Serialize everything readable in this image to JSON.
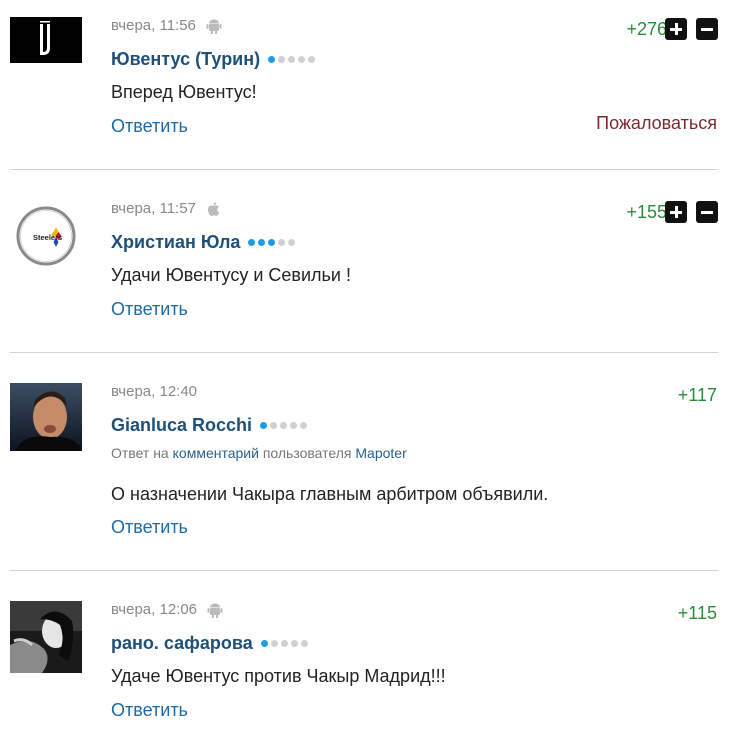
{
  "comments": [
    {
      "avatar_icon": "juventus-logo-icon",
      "time": "вчера, 11:56",
      "platform_icon": "android-icon",
      "username": "Ювентус (Турин)",
      "rating_level": 1,
      "rating_max": 5,
      "text": "Вперед Ювентус!",
      "score": "+276",
      "reply_label": "Ответить",
      "complain_label": "Пожаловаться"
    },
    {
      "avatar_icon": "steelers-logo-icon",
      "avatar_text": "Steelers",
      "time": "вчера, 11:57",
      "platform_icon": "apple-icon",
      "username": "Христиан Юла",
      "rating_level": 3,
      "rating_max": 5,
      "text": "Удачи Ювентусу и Севильи !",
      "score": "+155",
      "reply_label": "Ответить"
    },
    {
      "avatar_icon": "user-photo-icon",
      "time": "вчера, 12:40",
      "username": "Gianluca Rocchi",
      "rating_level": 1,
      "rating_max": 5,
      "reply_to_prefix": "Ответ на",
      "reply_to_link": "комментарий",
      "reply_to_middle": "пользователя",
      "reply_to_user": "Mapoter",
      "text": "О назначении Чакыра главным арбитром объявили.",
      "score": "+117",
      "reply_label": "Ответить"
    },
    {
      "avatar_icon": "user-photo-icon",
      "time": "вчера, 12:06",
      "platform_icon": "android-icon",
      "username": "рано. сафарова",
      "rating_level": 1,
      "rating_max": 5,
      "text": "Удаче Ювентус против Чакыр Мадрид!!!",
      "score": "+115",
      "reply_label": "Ответить"
    }
  ],
  "colors": {
    "username": "#1e5078",
    "link": "#1f6aa5",
    "score": "#2e8b3a",
    "complain": "#7a2a30",
    "rating_on": "#1f9be3"
  }
}
